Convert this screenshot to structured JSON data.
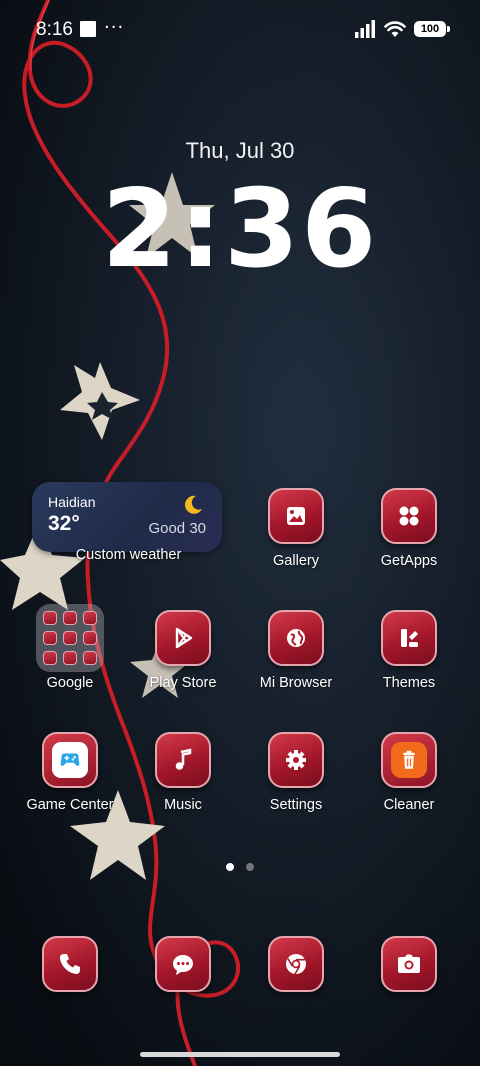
{
  "status_bar": {
    "time": "8:16",
    "dots": "···",
    "battery": "100"
  },
  "lockclock": {
    "date": "Thu, Jul 30",
    "time": "2:36"
  },
  "weather_widget": {
    "city": "Haidian",
    "temperature": "32°",
    "air_quality": "Good 30",
    "icon": "crescent-moon-icon",
    "label": "Custom weather"
  },
  "apps": {
    "gallery": "Gallery",
    "getapps": "GetApps",
    "google": "Google",
    "play_store": "Play Store",
    "mi_browser": "Mi Browser",
    "themes": "Themes",
    "game_center": "Game Center",
    "music": "Music",
    "settings": "Settings",
    "cleaner": "Cleaner"
  },
  "dock": {
    "phone": "phone-icon",
    "messages": "messages-icon",
    "chrome": "chrome-icon",
    "camera": "camera-icon"
  },
  "page_indicator": {
    "pages": 2,
    "current": 1
  },
  "colors": {
    "icon_red": "#a3162a",
    "icon_border": "#e6a5ae",
    "widget_bg": "#1f2a48",
    "moon": "#f5b81f",
    "cleaner_orange": "#f26a1b"
  }
}
